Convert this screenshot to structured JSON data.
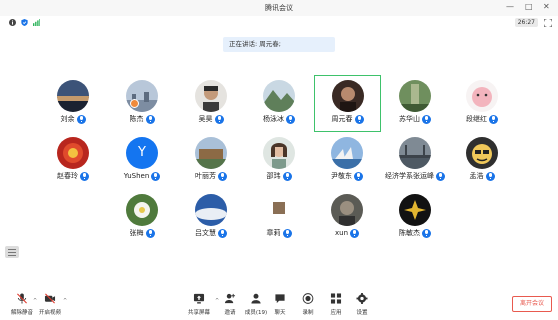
{
  "window": {
    "title": "腾讯会议",
    "controls": [
      "—",
      "□",
      "✕"
    ]
  },
  "status": {
    "timer": "26:27"
  },
  "speaking_banner": {
    "text": "正在讲话: 周元春;"
  },
  "colors": {
    "accent": "#1a74e8",
    "selected_border": "#3ec26b",
    "leave": "#e85a4f",
    "host_badge": "#f08a3a"
  },
  "participants": [
    {
      "name": "刘余",
      "avatar_icon": "dusk-landscape-avatar"
    },
    {
      "name": "陈杰",
      "avatar_icon": "city-sky-avatar"
    },
    {
      "name": "吴昊",
      "avatar_icon": "man-glasses-avatar"
    },
    {
      "name": "杨泳冰",
      "avatar_icon": "mountain-avatar"
    },
    {
      "name": "周元春",
      "avatar_icon": "portrait-avatar",
      "selected": true
    },
    {
      "name": "苏华山",
      "avatar_icon": "forest-avatar"
    },
    {
      "name": "段继红",
      "avatar_icon": "pink-cartoon-avatar"
    },
    {
      "name": "赵春玲",
      "avatar_icon": "red-lantern-avatar"
    },
    {
      "name": "YuShen",
      "avatar_icon": "letter-y-avatar",
      "letter": "Y"
    },
    {
      "name": "叶丽芳",
      "avatar_icon": "temple-avatar"
    },
    {
      "name": "邵玮",
      "avatar_icon": "woman-portrait-avatar"
    },
    {
      "name": "尹敬东",
      "avatar_icon": "opera-house-avatar"
    },
    {
      "name": "经济学系张运峰",
      "avatar_icon": "bridge-avatar"
    },
    {
      "name": "孟浩",
      "avatar_icon": "cartoon-face-avatar"
    },
    {
      "name": "张梅",
      "avatar_icon": "white-flower-avatar"
    },
    {
      "name": "吕文慧",
      "avatar_icon": "sky-avatar"
    },
    {
      "name": "章莉",
      "avatar_icon": "small-photo-avatar"
    },
    {
      "name": "xun",
      "avatar_icon": "dark-portrait-avatar"
    },
    {
      "name": "陈敏杰",
      "avatar_icon": "gold-flower-avatar"
    }
  ],
  "toolbar": {
    "unmute": "解除静音",
    "start_video": "开启视频",
    "share_screen": "共享屏幕",
    "invite": "邀请",
    "members": "成员(19)",
    "chat": "聊天",
    "record": "录制",
    "apps": "应用",
    "settings": "设置",
    "leave": "离开会议"
  }
}
